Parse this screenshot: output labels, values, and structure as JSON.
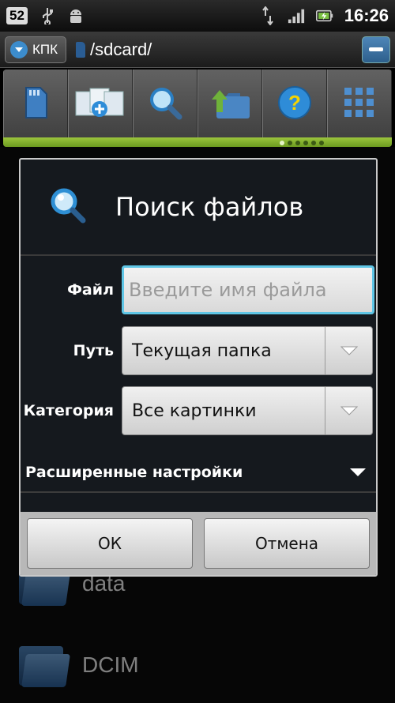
{
  "status_bar": {
    "notification_count": "52",
    "time": "16:26",
    "icons": [
      "usb-icon",
      "android-debug-icon",
      "data-transfer-icon",
      "signal-icon",
      "battery-icon"
    ]
  },
  "path_bar": {
    "kpk_label": "КПК",
    "path": "/sdcard/"
  },
  "toolbar": {
    "buttons": [
      "sd-card-icon",
      "multi-select-icon",
      "search-icon",
      "up-folder-icon",
      "help-icon",
      "grid-view-icon"
    ],
    "accent": "#8fbc33",
    "page_indicator": {
      "total": 6,
      "active": 1
    }
  },
  "file_list": {
    "items": [
      {
        "name": "data",
        "icon": "folder-icon"
      },
      {
        "name": "DCIM",
        "icon": "folder-icon"
      }
    ]
  },
  "dialog": {
    "title": "Поиск файлов",
    "file_label": "Файл",
    "file_placeholder": "Введите имя файла",
    "file_value": "",
    "path_label": "Путь",
    "path_value": "Текущая папка",
    "category_label": "Категория",
    "category_value": "Все картинки",
    "advanced_label": "Расширенные настройки",
    "ok_label": "ОК",
    "cancel_label": "Отмена",
    "focus_color": "#5fc6e6"
  }
}
